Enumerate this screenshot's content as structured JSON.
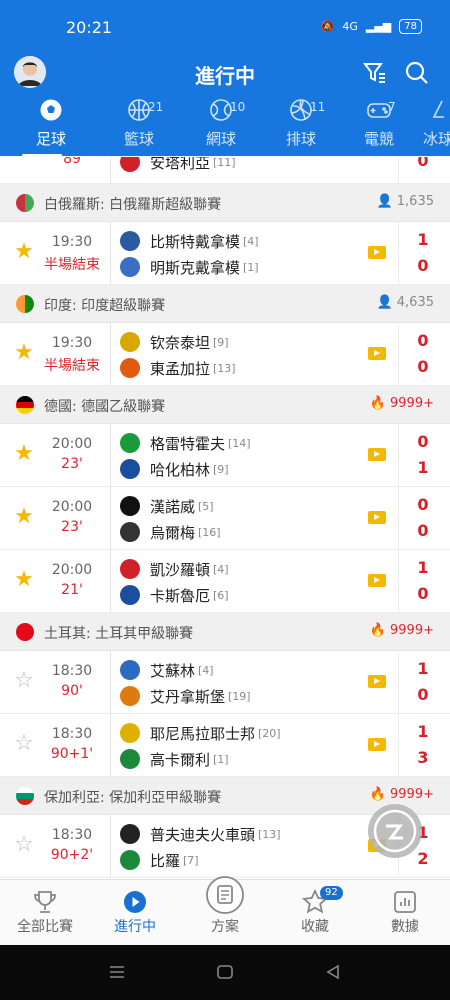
{
  "status_bar": {
    "time": "20:21",
    "network": "4G",
    "battery": "78"
  },
  "header": {
    "title": "進行中"
  },
  "tabs": [
    {
      "label": "足球",
      "count": ""
    },
    {
      "label": "籃球",
      "count": "21"
    },
    {
      "label": "網球",
      "count": "10"
    },
    {
      "label": "排球",
      "count": "11"
    },
    {
      "label": "電競",
      "count": "7"
    },
    {
      "label": "冰球",
      "count": ""
    }
  ],
  "partial_row": {
    "team": "安塔利亞",
    "rank": "[11]",
    "score": "0",
    "time_cut": "89"
  },
  "leagues": [
    {
      "name": "白俄羅斯: 白俄羅斯超級聯賽",
      "meta": "1,635",
      "hot": false,
      "flag_colors": [
        "#c8313e",
        "#4aa657"
      ],
      "matches": [
        {
          "time": "19:30",
          "status": "半場結束",
          "starred": true,
          "home": {
            "name": "比斯特戴拿模",
            "rank": "[4]",
            "crest": "#2c5aa0"
          },
          "away": {
            "name": "明斯克戴拿模",
            "rank": "[1]",
            "crest": "#3a6fc4"
          },
          "score": [
            "1",
            "0"
          ]
        }
      ]
    },
    {
      "name": "印度: 印度超級聯賽",
      "meta": "4,635",
      "hot": false,
      "flag_colors": [
        "#ff9933",
        "#138808"
      ],
      "matches": [
        {
          "time": "19:30",
          "status": "半場結束",
          "starred": true,
          "home": {
            "name": "钦奈泰坦",
            "rank": "[9]",
            "crest": "#d8a800"
          },
          "away": {
            "name": "東孟加拉",
            "rank": "[13]",
            "crest": "#e05a10"
          },
          "score": [
            "0",
            "0"
          ]
        }
      ]
    },
    {
      "name": "德國: 德國乙級聯賽",
      "meta": "9999+",
      "hot": true,
      "flag_colors": [
        "#000000",
        "#dd0000",
        "#ffce00"
      ],
      "matches": [
        {
          "time": "20:00",
          "status": "23'",
          "starred": true,
          "home": {
            "name": "格雷特霍夫",
            "rank": "[14]",
            "crest": "#1a9a3a"
          },
          "away": {
            "name": "哈化柏林",
            "rank": "[9]",
            "crest": "#1a4fa0"
          },
          "score": [
            "0",
            "1"
          ]
        },
        {
          "time": "20:00",
          "status": "23'",
          "starred": true,
          "home": {
            "name": "漢諾威",
            "rank": "[5]",
            "crest": "#111111"
          },
          "away": {
            "name": "烏爾梅",
            "rank": "[16]",
            "crest": "#333333"
          },
          "score": [
            "0",
            "0"
          ]
        },
        {
          "time": "20:00",
          "status": "21'",
          "starred": true,
          "home": {
            "name": "凱沙羅頓",
            "rank": "[4]",
            "crest": "#d0202a"
          },
          "away": {
            "name": "卡斯魯厄",
            "rank": "[6]",
            "crest": "#1a4fa0"
          },
          "score": [
            "1",
            "0"
          ]
        }
      ]
    },
    {
      "name": "土耳其: 土耳其甲級聯賽",
      "meta": "9999+",
      "hot": true,
      "flag_colors": [
        "#e30a17",
        "#e30a17"
      ],
      "matches": [
        {
          "time": "18:30",
          "status": "90'",
          "starred": false,
          "home": {
            "name": "艾蘇林",
            "rank": "[4]",
            "crest": "#2a6ac0"
          },
          "away": {
            "name": "艾丹拿斯堡",
            "rank": "[19]",
            "crest": "#e07a10"
          },
          "score": [
            "1",
            "0"
          ]
        },
        {
          "time": "18:30",
          "status": "90+1'",
          "starred": false,
          "home": {
            "name": "耶尼馬拉耶士邦",
            "rank": "[20]",
            "crest": "#e0b000"
          },
          "away": {
            "name": "高卡爾利",
            "rank": "[1]",
            "crest": "#1a8a3a"
          },
          "score": [
            "1",
            "3"
          ]
        }
      ]
    },
    {
      "name": "保加利亞: 保加利亞甲級聯賽",
      "meta": "9999+",
      "hot": true,
      "flag_colors": [
        "#ffffff",
        "#00966e",
        "#d62612"
      ],
      "matches": [
        {
          "time": "18:30",
          "status": "90+2'",
          "starred": false,
          "home": {
            "name": "普夫迪夫火車頭",
            "rank": "[13]",
            "crest": "#222222"
          },
          "away": {
            "name": "比羅",
            "rank": "[7]",
            "crest": "#1a8a3a"
          },
          "score": [
            "1",
            "2"
          ]
        }
      ]
    }
  ],
  "bottom_nav": [
    {
      "label": "全部比賽",
      "icon": "trophy-icon"
    },
    {
      "label": "進行中",
      "icon": "play-icon"
    },
    {
      "label": "方案",
      "icon": "document-icon"
    },
    {
      "label": "收藏",
      "icon": "star-icon",
      "badge": "92"
    },
    {
      "label": "數據",
      "icon": "chart-icon"
    }
  ]
}
